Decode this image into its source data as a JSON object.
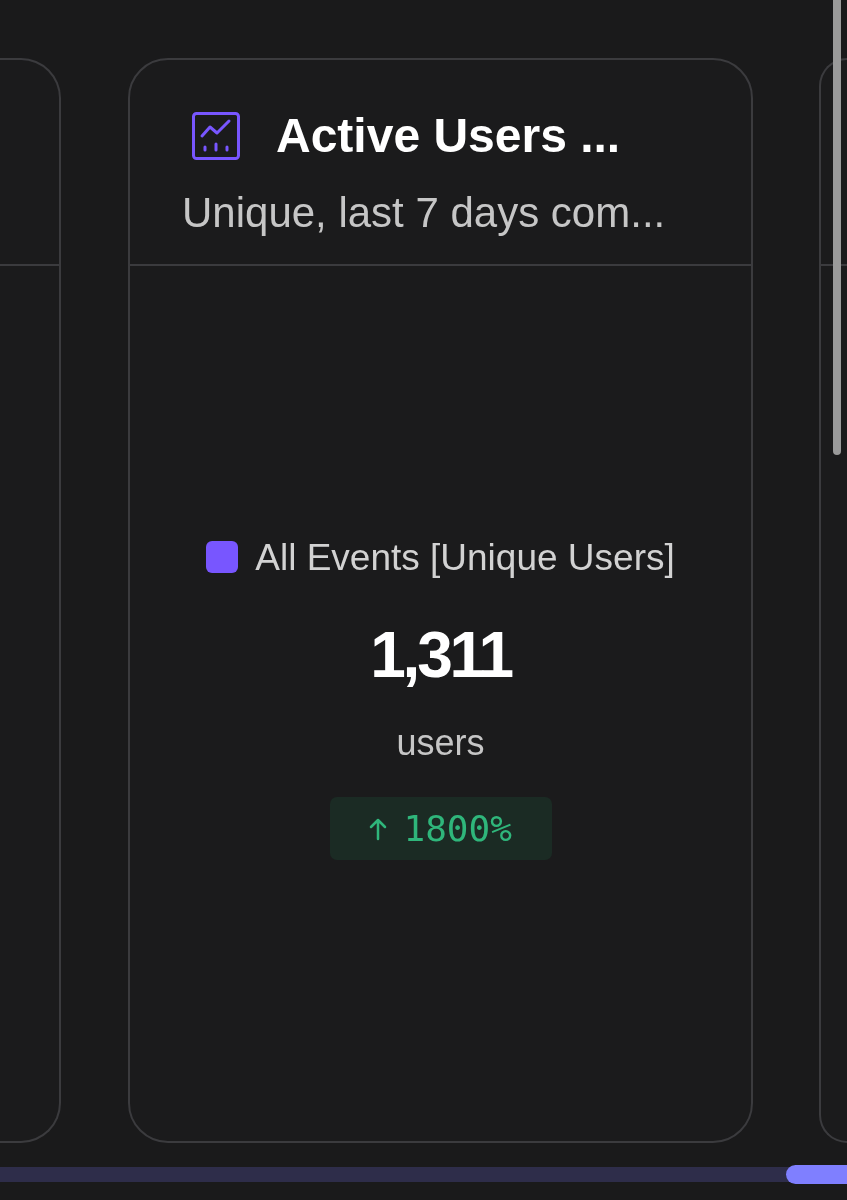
{
  "report": {
    "title": "Active Users ...",
    "subtitle": "Unique, last 7 days com..."
  },
  "metric": {
    "legend": [
      {
        "label": "All Events [Unique Users]",
        "color": "#7856ff"
      }
    ],
    "value": "1,311",
    "unit": "users",
    "change": {
      "text": "1800%",
      "increase": true
    }
  }
}
